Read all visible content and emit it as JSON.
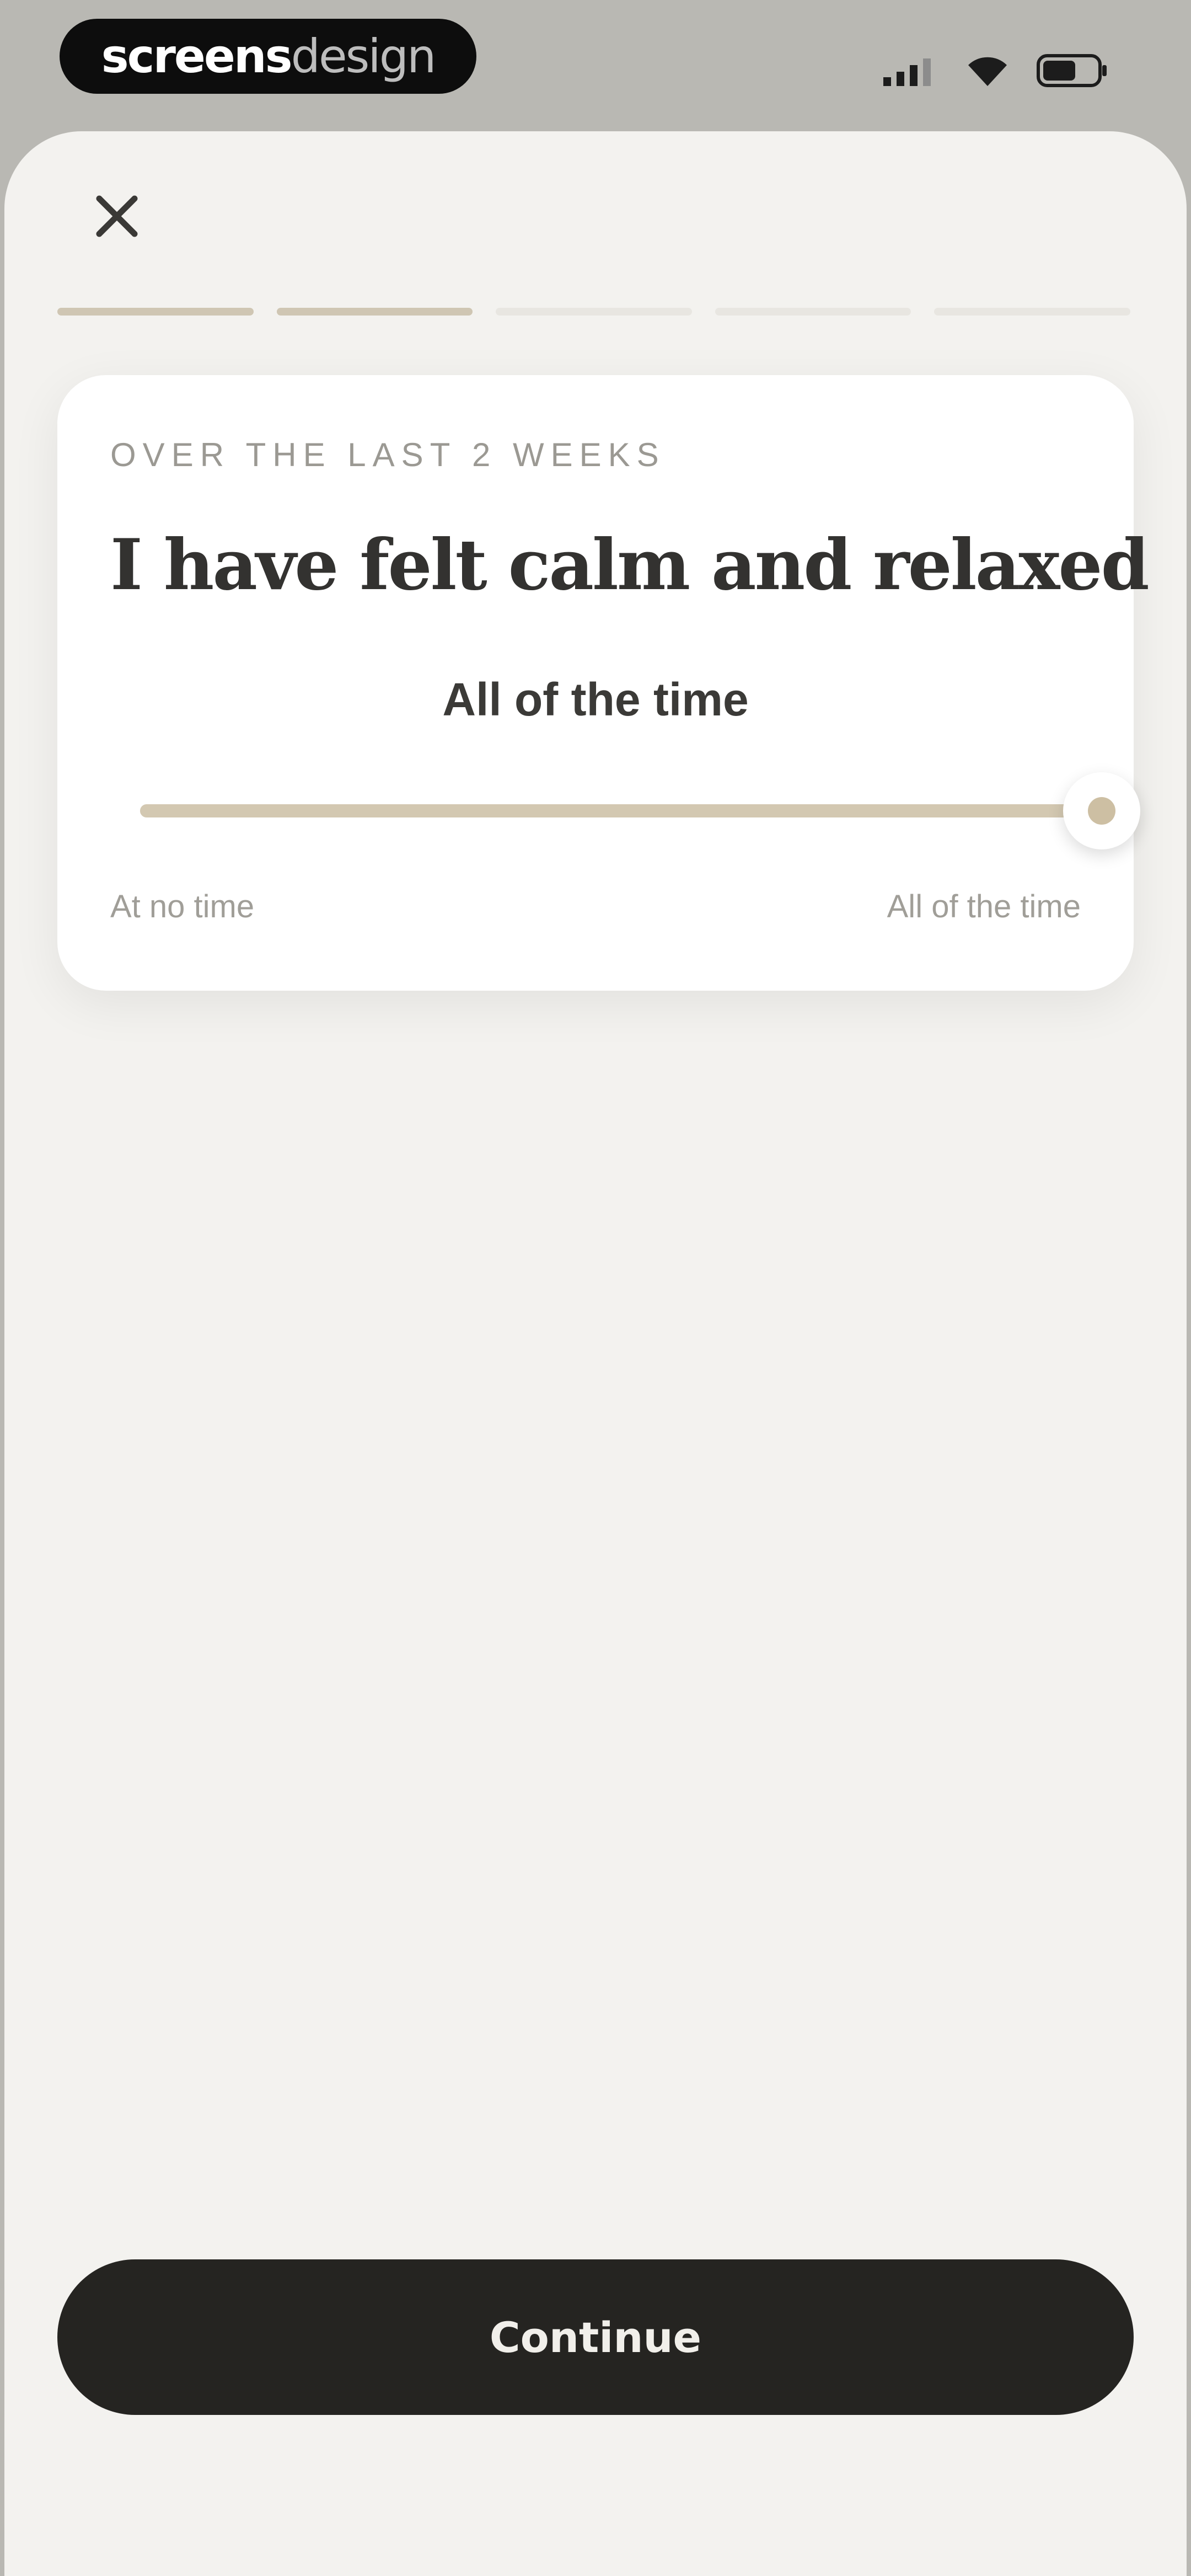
{
  "status_bar": {
    "brand": {
      "strong": "screens",
      "light": "design"
    },
    "icons": [
      "signal-icon",
      "wifi-icon",
      "battery-icon"
    ]
  },
  "header": {
    "close_icon": "close-icon",
    "progress": {
      "total_steps": 5,
      "completed_steps": 2
    }
  },
  "question_card": {
    "eyebrow": "OVER THE LAST 2 WEEKS",
    "question": "I have felt calm and relaxed",
    "current_value_label": "All of the time",
    "slider": {
      "value": 1.0
    },
    "scale_min_label": "At no time",
    "scale_max_label": "All of the time"
  },
  "footer": {
    "continue_label": "Continue"
  },
  "colors": {
    "accent": "#d3c8b1",
    "background": "#f3f2ef",
    "button": "#252421",
    "text": "#333230"
  }
}
